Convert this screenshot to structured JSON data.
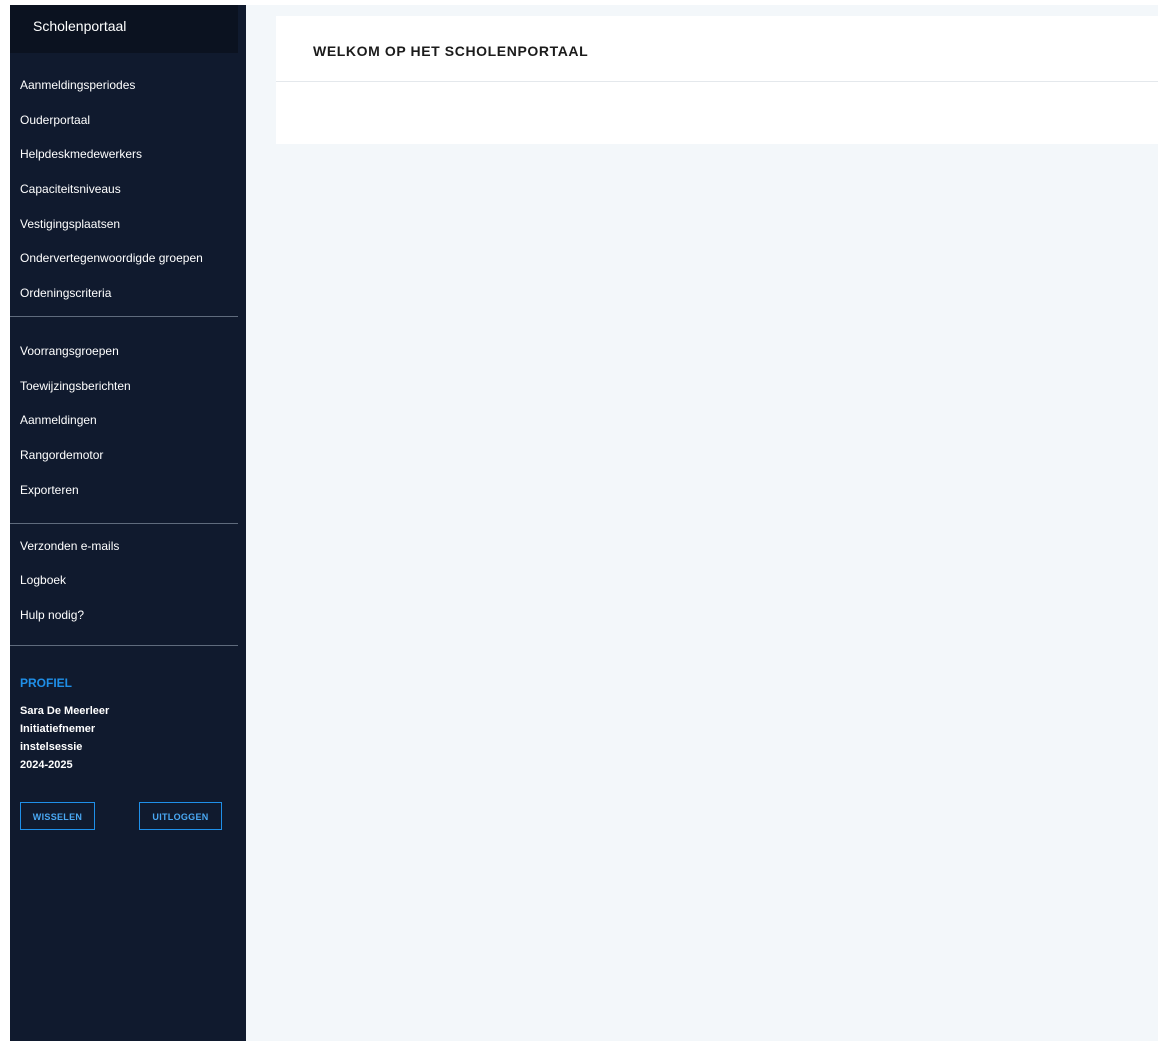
{
  "sidebar": {
    "brand": "Scholenportaal",
    "groups": [
      [
        "Aanmeldingsperiodes",
        "Ouderportaal",
        "Helpdeskmedewerkers",
        "Capaciteitsniveaus",
        "Vestigingsplaatsen",
        "Ondervertegenwoordigde groepen",
        "Ordeningscriteria"
      ],
      [
        "Voorrangsgroepen",
        "Toewijzingsberichten",
        "Aanmeldingen",
        "Rangordemotor",
        "Exporteren"
      ],
      [
        "Verzonden e-mails",
        "Logboek",
        "Hulp nodig?"
      ]
    ]
  },
  "profile": {
    "heading": "PROFIEL",
    "name": "Sara De Meerleer",
    "role": "Initiatiefnemer",
    "session": "instelsessie",
    "year": "2024-2025",
    "switch_label": "WISSELEN",
    "logout_label": "UITLOGGEN"
  },
  "main": {
    "title": "WELKOM OP HET SCHOLENPORTAAL"
  },
  "colors": {
    "sidebar_bg": "#101a2e",
    "brand_bg": "#0b1220",
    "accent": "#1f8fe8",
    "content_bg": "#f3f7fa"
  }
}
